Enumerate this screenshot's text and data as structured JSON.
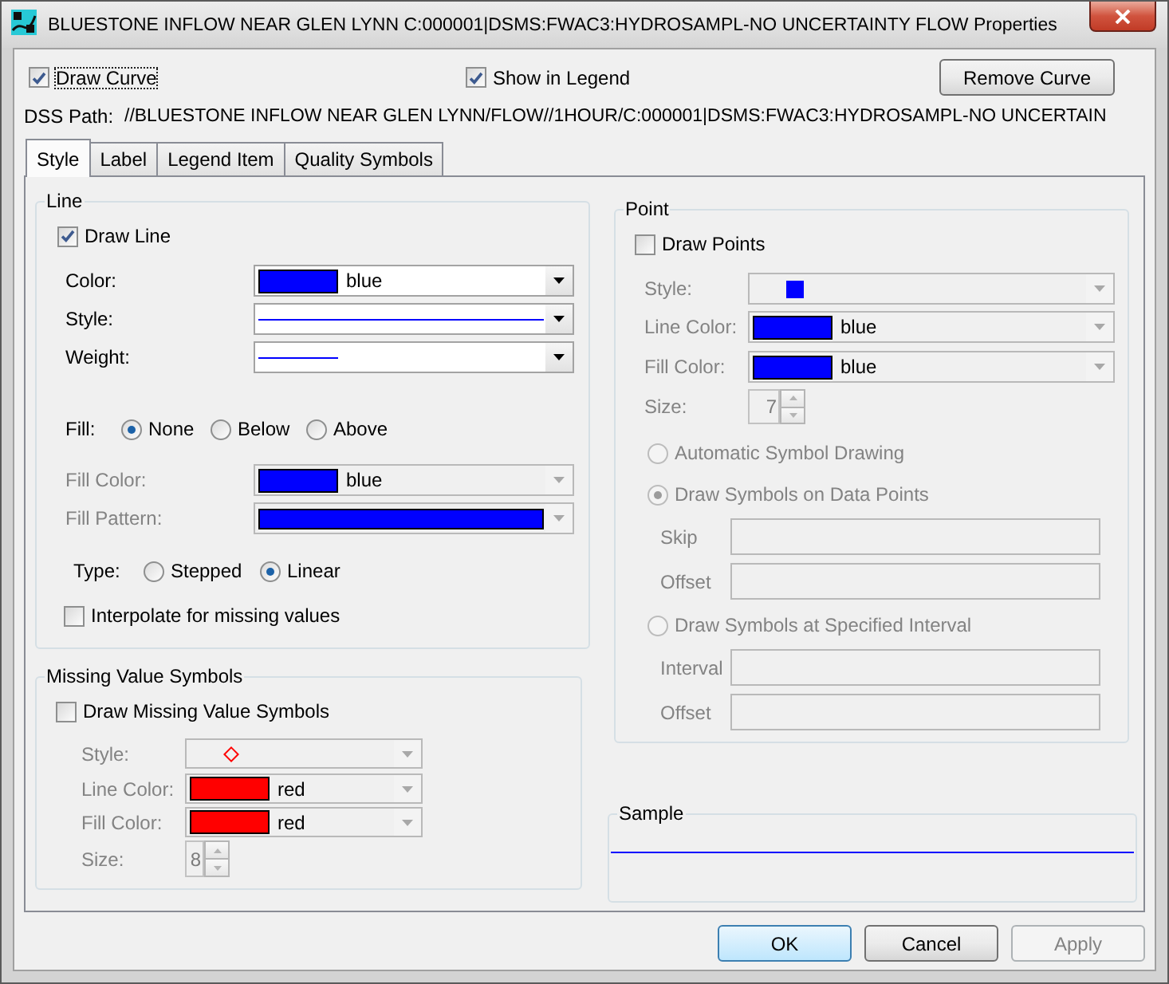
{
  "window": {
    "title": "BLUESTONE INFLOW NEAR GLEN LYNN C:000001|DSMS:FWAC3:HYDROSAMPL-NO UNCERTAINTY FLOW Properties"
  },
  "options": [
    {
      "label": "Draw Curve",
      "checked": true,
      "focused": true
    },
    {
      "label": "Show in Legend",
      "checked": true,
      "focused": false
    }
  ],
  "remove_button": {
    "label": "Remove Curve"
  },
  "dss_path": {
    "label": "DSS Path:",
    "value": "//BLUESTONE INFLOW NEAR GLEN LYNN/FLOW//1HOUR/C:000001|DSMS:FWAC3:HYDROSAMPL-NO UNCERTAIN"
  },
  "tabs": [
    {
      "label": "Style",
      "selected": true
    },
    {
      "label": "Label",
      "selected": false
    },
    {
      "label": "Legend Item",
      "selected": false
    },
    {
      "label": "Quality Symbols",
      "selected": false
    }
  ],
  "line": {
    "title": "Line",
    "draw_line": {
      "label": "Draw Line",
      "checked": true
    },
    "fields": [
      {
        "kind": "color",
        "label": "Color:",
        "value": "blue",
        "color": "#0000ff",
        "disabled": false
      },
      {
        "kind": "line",
        "label": "Style:",
        "color": "#0000ff",
        "disabled": false
      },
      {
        "kind": "weight",
        "label": "Weight:",
        "color": "#0000ff",
        "disabled": false
      }
    ],
    "fill": {
      "label": "Fill:",
      "options": [
        {
          "label": "None",
          "selected": true
        },
        {
          "label": "Below",
          "selected": false
        },
        {
          "label": "Above",
          "selected": false
        }
      ]
    },
    "fill_fields": [
      {
        "kind": "color",
        "label": "Fill Color:",
        "value": "blue",
        "color": "#0000ff",
        "disabled": true
      },
      {
        "kind": "pattern",
        "label": "Fill Pattern:",
        "color": "#0000ff",
        "disabled": true
      }
    ],
    "type": {
      "label": "Type:",
      "options": [
        {
          "label": "Stepped",
          "selected": false
        },
        {
          "label": "Linear",
          "selected": true
        }
      ]
    },
    "interpolate": {
      "label": "Interpolate for missing values",
      "checked": false
    }
  },
  "missing_values": {
    "title": "Missing Value Symbols",
    "draw": {
      "label": "Draw Missing Value Symbols",
      "checked": false
    },
    "fields": [
      {
        "kind": "diamond",
        "label": "Style:",
        "color": "#ff0000",
        "disabled": true
      },
      {
        "kind": "color",
        "label": "Line Color:",
        "value": "red",
        "color": "#ff0000",
        "disabled": true
      },
      {
        "kind": "color",
        "label": "Fill Color:",
        "value": "red",
        "color": "#ff0000",
        "disabled": true
      },
      {
        "kind": "spinner",
        "label": "Size:",
        "value": "8",
        "disabled": true
      }
    ]
  },
  "point": {
    "title": "Point",
    "draw": {
      "label": "Draw Points",
      "checked": false
    },
    "fields": [
      {
        "kind": "square",
        "label": "Style:",
        "color": "#0000ff",
        "disabled": true
      },
      {
        "kind": "color",
        "label": "Line Color:",
        "value": "blue",
        "color": "#0000ff",
        "disabled": true
      },
      {
        "kind": "color",
        "label": "Fill Color:",
        "value": "blue",
        "color": "#0000ff",
        "disabled": true
      },
      {
        "kind": "spinner",
        "label": "Size:",
        "value": "7",
        "disabled": true
      }
    ],
    "modes": [
      {
        "label": "Automatic Symbol Drawing",
        "selected": false,
        "disabled": true
      },
      {
        "label": "Draw Symbols on Data Points",
        "selected": true,
        "disabled": true,
        "inputs": [
          {
            "label": "Skip",
            "disabled": true
          },
          {
            "label": "Offset",
            "disabled": true
          }
        ]
      },
      {
        "label": "Draw Symbols at Specified Interval",
        "selected": false,
        "disabled": true,
        "inputs": [
          {
            "label": "Interval",
            "disabled": true
          },
          {
            "label": "Offset",
            "disabled": true
          }
        ]
      }
    ]
  },
  "sample": {
    "title": "Sample",
    "color": "#0000ff"
  },
  "buttons": [
    {
      "label": "OK",
      "focused": true,
      "disabled": false
    },
    {
      "label": "Cancel",
      "focused": false,
      "disabled": false
    },
    {
      "label": "Apply",
      "focused": false,
      "disabled": true
    }
  ]
}
